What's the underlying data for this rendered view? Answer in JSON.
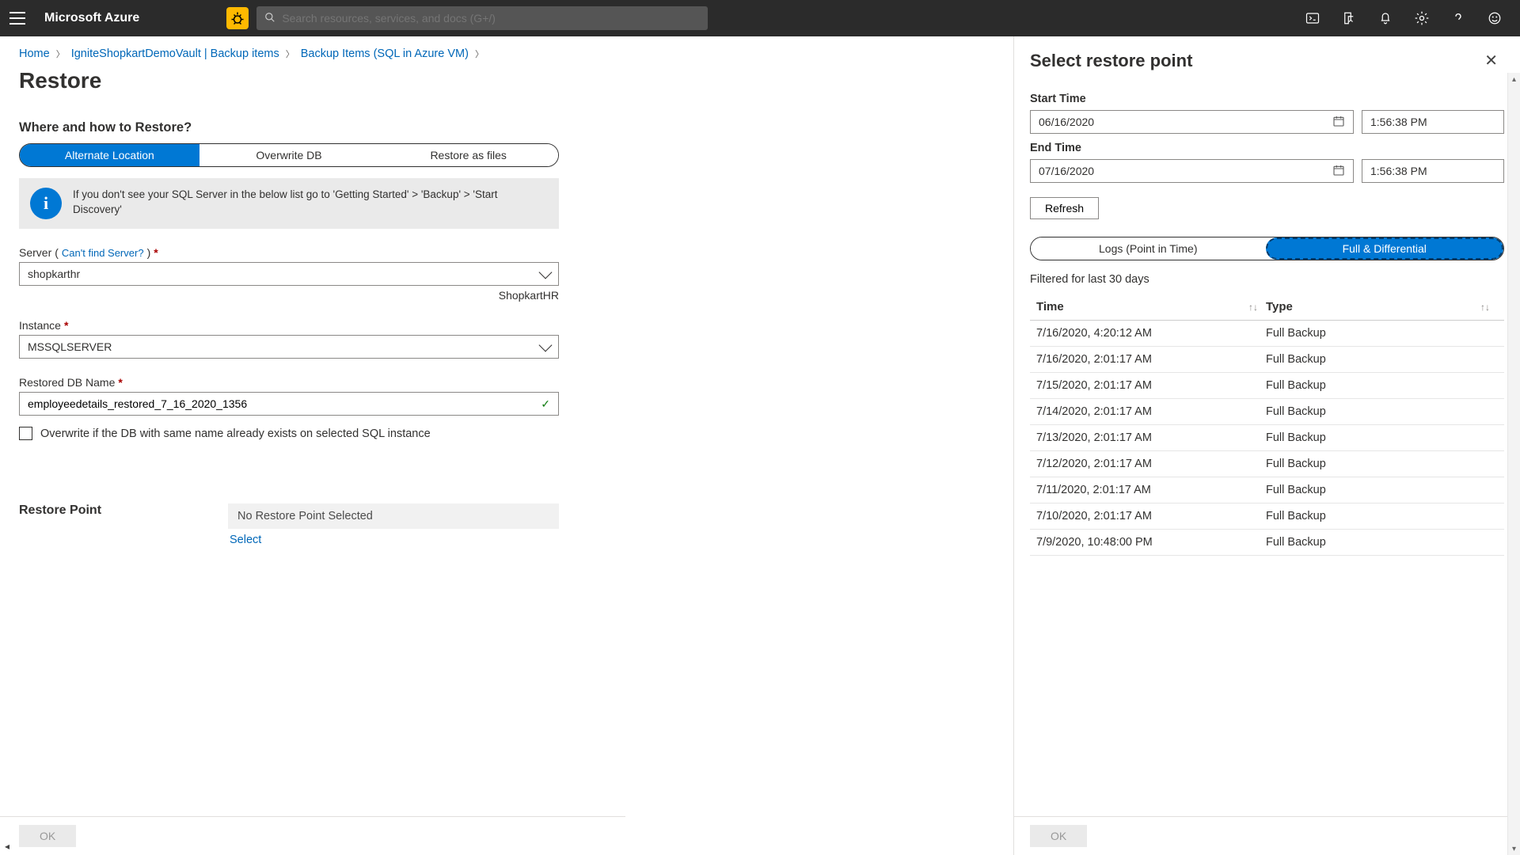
{
  "topbar": {
    "brand": "Microsoft Azure",
    "search_placeholder": "Search resources, services, and docs (G+/)"
  },
  "breadcrumbs": {
    "home": "Home",
    "vault": "IgniteShopkartDemoVault | Backup items",
    "items": "Backup Items (SQL in Azure VM)"
  },
  "page": {
    "title": "Restore"
  },
  "where": {
    "heading": "Where and how to Restore?",
    "seg_alt": "Alternate Location",
    "seg_overwrite": "Overwrite DB",
    "seg_files": "Restore as files",
    "info": "If you don't see your SQL Server in the below list go to 'Getting Started' > 'Backup' > 'Start Discovery'"
  },
  "form": {
    "server_label": "Server",
    "server_sublink": "Can't find Server?",
    "server_value": "shopkarthr",
    "server_helper": "ShopkartHR",
    "instance_label": "Instance",
    "instance_value": "MSSQLSERVER",
    "dbname_label": "Restored DB Name",
    "dbname_value": "employeedetails_restored_7_16_2020_1356",
    "overwrite_cb": "Overwrite if the DB with same name already exists on selected SQL instance"
  },
  "restore_point": {
    "label": "Restore Point",
    "status": "No Restore Point Selected",
    "select_link": "Select"
  },
  "footer": {
    "ok": "OK"
  },
  "flyout": {
    "title": "Select restore point",
    "start_label": "Start Time",
    "start_date": "06/16/2020",
    "start_time": "1:56:38 PM",
    "end_label": "End Time",
    "end_date": "07/16/2020",
    "end_time": "1:56:38 PM",
    "refresh": "Refresh",
    "tab_logs": "Logs (Point in Time)",
    "tab_full": "Full & Differential",
    "filter_note": "Filtered for last 30 days",
    "col_time": "Time",
    "col_type": "Type",
    "rows": [
      {
        "time": "7/16/2020, 4:20:12 AM",
        "type": "Full Backup"
      },
      {
        "time": "7/16/2020, 2:01:17 AM",
        "type": "Full Backup"
      },
      {
        "time": "7/15/2020, 2:01:17 AM",
        "type": "Full Backup"
      },
      {
        "time": "7/14/2020, 2:01:17 AM",
        "type": "Full Backup"
      },
      {
        "time": "7/13/2020, 2:01:17 AM",
        "type": "Full Backup"
      },
      {
        "time": "7/12/2020, 2:01:17 AM",
        "type": "Full Backup"
      },
      {
        "time": "7/11/2020, 2:01:17 AM",
        "type": "Full Backup"
      },
      {
        "time": "7/10/2020, 2:01:17 AM",
        "type": "Full Backup"
      },
      {
        "time": "7/9/2020, 10:48:00 PM",
        "type": "Full Backup"
      }
    ],
    "ok": "OK"
  }
}
